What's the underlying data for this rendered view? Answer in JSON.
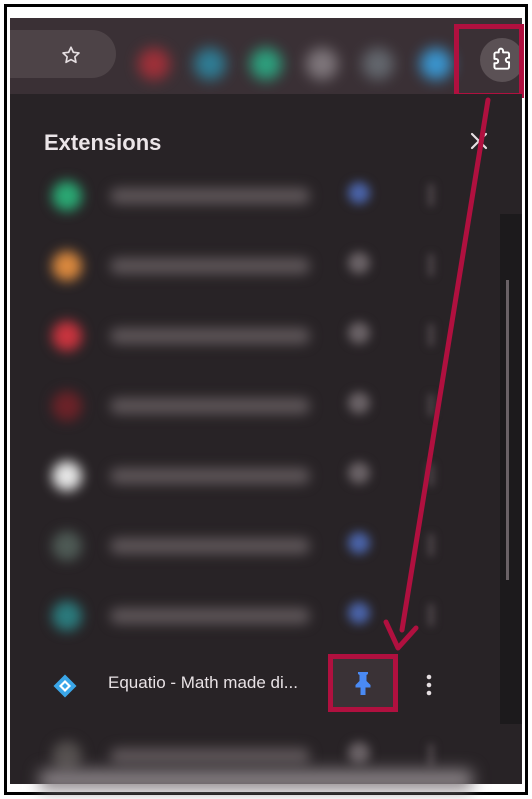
{
  "popup": {
    "title": "Extensions"
  },
  "toolbar": {
    "bookmark_icon": "star-icon",
    "extensions_icon": "puzzle-piece-icon"
  },
  "extensions": [
    {
      "state": "blurred",
      "icon_color": "#2aa873",
      "pin_color": "#4a63a8"
    },
    {
      "state": "blurred",
      "icon_color": "#d9883e",
      "pin_color": "#6a6266"
    },
    {
      "state": "blurred",
      "icon_color": "#c8343e",
      "pin_color": "#6a6266"
    },
    {
      "state": "blurred",
      "icon_color": "#6b2228",
      "pin_color": "#6a6266"
    },
    {
      "state": "blurred",
      "icon_color": "#e6e6e6",
      "pin_color": "#6a6266"
    },
    {
      "state": "blurred",
      "icon_color": "#4e5a55",
      "pin_color": "#4a63a8"
    },
    {
      "state": "blurred",
      "icon_color": "#2b7a7c",
      "pin_color": "#4a63a8"
    },
    {
      "name": "Equatio - Math made di...",
      "icon_color": "#3aa6e8",
      "pinned": true,
      "pin_color": "#4a8af4"
    },
    {
      "state": "blurred",
      "icon_color": "#55504f",
      "pin_color": "#6a6266"
    }
  ],
  "colors": {
    "highlight": "#b0103f",
    "popup_bg": "#282326",
    "toolbar_bg": "#3a3035"
  }
}
